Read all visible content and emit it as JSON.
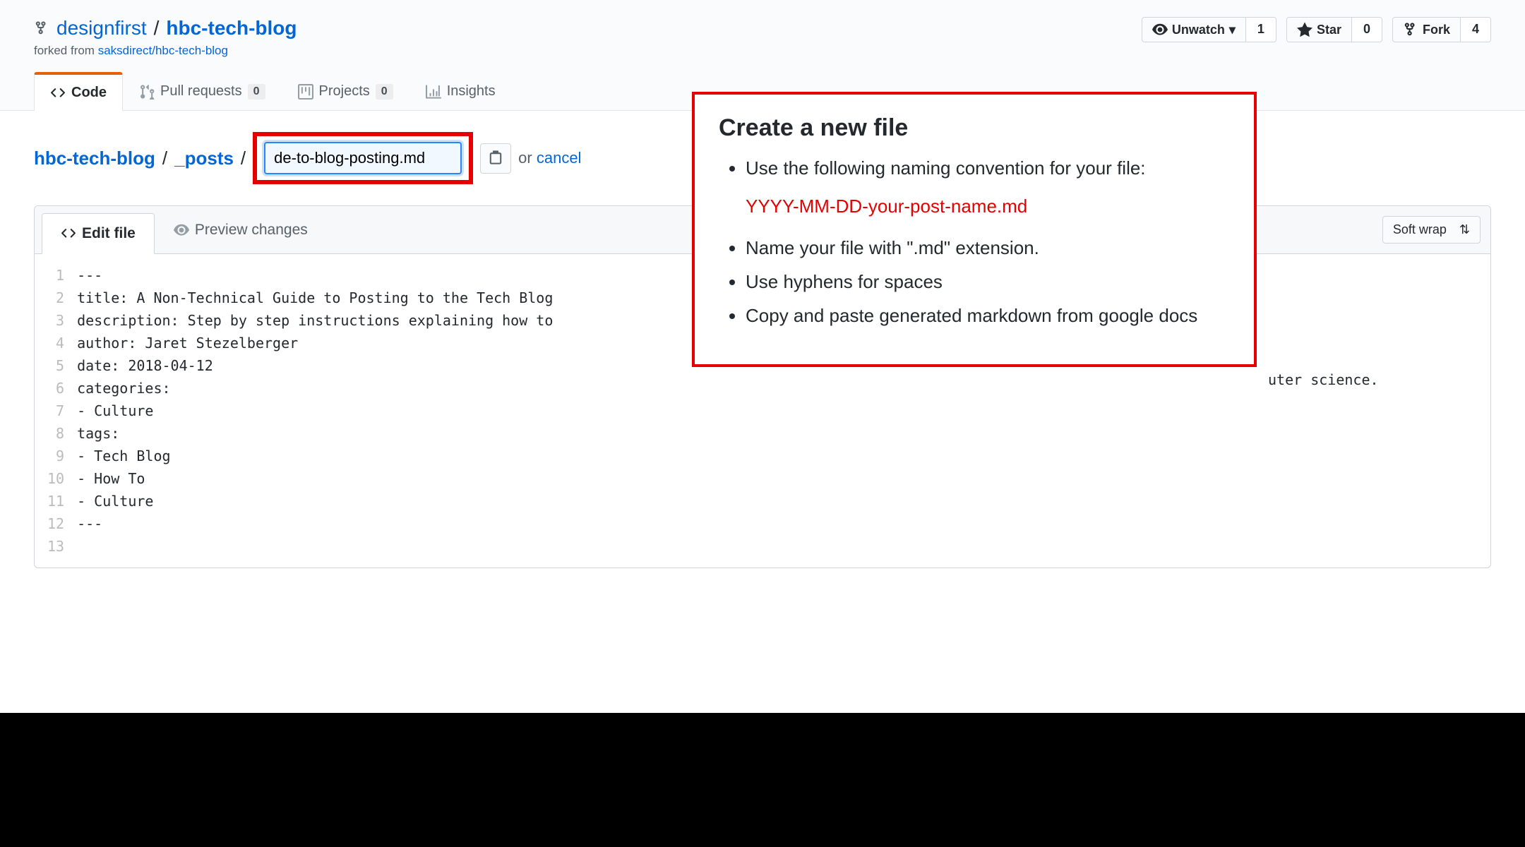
{
  "repo": {
    "owner": "designfirst",
    "name": "hbc-tech-blog",
    "forked_from_label": "forked from ",
    "forked_from_link": "saksdirect/hbc-tech-blog"
  },
  "actions": {
    "unwatch": {
      "label": "Unwatch",
      "count": "1"
    },
    "star": {
      "label": "Star",
      "count": "0"
    },
    "fork": {
      "label": "Fork",
      "count": "4"
    }
  },
  "tabs": {
    "code": "Code",
    "pr": "Pull requests",
    "pr_count": "0",
    "projects": "Projects",
    "projects_count": "0",
    "insights": "Insights"
  },
  "breadcrumb": {
    "root": "hbc-tech-blog",
    "folder": "_posts",
    "filename_value": "de-to-blog-posting.md",
    "or": "or",
    "cancel": "cancel"
  },
  "editor_tabs": {
    "edit": "Edit file",
    "preview": "Preview changes",
    "wrap": "Soft wrap"
  },
  "code_lines": [
    "---",
    "title: A Non-Technical Guide to Posting to the Tech Blog",
    "description: Step by step instructions explaining how to",
    "author: Jaret Stezelberger",
    "date: 2018-04-12",
    "categories:",
    "- Culture",
    "tags:",
    "- Tech Blog",
    "- How To",
    "- Culture",
    "---",
    ""
  ],
  "trailing_fragment": "uter science.",
  "overlay": {
    "title": "Create a new file",
    "bullet1": "Use the following naming convention for your file:",
    "convention": "YYYY-MM-DD-your-post-name.md",
    "bullet2": "Name your file with \".md\" extension.",
    "bullet3": "Use hyphens for spaces",
    "bullet4": "Copy and paste generated markdown from google docs"
  }
}
